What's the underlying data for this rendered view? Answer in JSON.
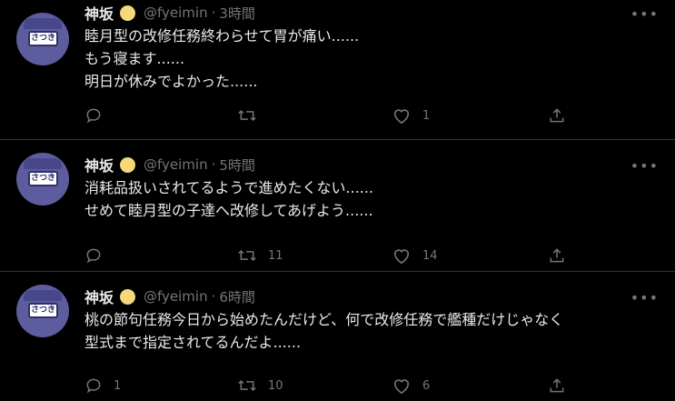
{
  "tweets": [
    {
      "display_name": "神坂",
      "handle": "@fyeimin",
      "separator": "·",
      "time": "3時間",
      "lines": [
        "睦月型の改修任務終わらせて胃が痛い......",
        "もう寝ます......",
        "明日が休みでよかった......"
      ],
      "reply_count": "",
      "retweet_count": "",
      "like_count": "1"
    },
    {
      "display_name": "神坂",
      "handle": "@fyeimin",
      "separator": "·",
      "time": "5時間",
      "lines": [
        "消耗品扱いされてるようで進めたくない......",
        "せめて睦月型の子達へ改修してあげよう......"
      ],
      "reply_count": "",
      "retweet_count": "11",
      "like_count": "14"
    },
    {
      "display_name": "神坂",
      "handle": "@fyeimin",
      "separator": "·",
      "time": "6時間",
      "lines": [
        "桃の節句任務今日から始めたんだけど、何で改修任務で艦種だけじゃなく",
        "型式まで指定されてるんだよ......"
      ],
      "reply_count": "1",
      "retweet_count": "10",
      "like_count": "6"
    }
  ],
  "avatar_badge_text": "さつき",
  "icons": {
    "reply": "reply-icon",
    "retweet": "retweet-icon",
    "like": "heart-icon",
    "share": "share-icon",
    "more": "more-icon",
    "emoji": "moon-emoji-icon"
  },
  "colors": {
    "background": "#000000",
    "text": "#e7e9ea",
    "muted": "#71767b",
    "divider": "#2f3336",
    "avatar": "#5d5c9e"
  }
}
